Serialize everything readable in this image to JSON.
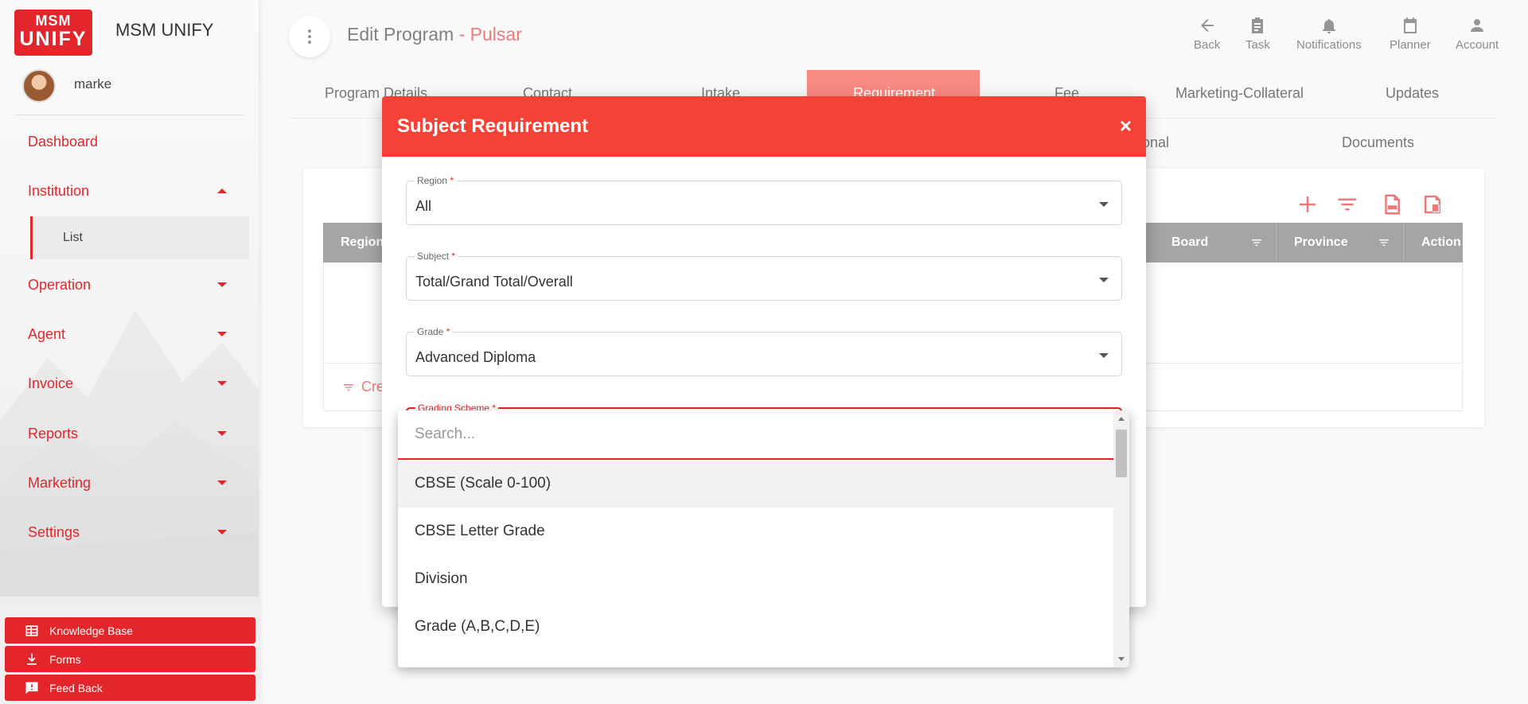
{
  "app": {
    "logo_line1": "MSM",
    "logo_line2": "UNIFY",
    "brand": "MSM UNIFY",
    "user": "marke"
  },
  "sidebar": {
    "items": [
      {
        "label": "Dashboard"
      },
      {
        "label": "Institution"
      },
      {
        "label": "List"
      },
      {
        "label": "Operation"
      },
      {
        "label": "Agent"
      },
      {
        "label": "Invoice"
      },
      {
        "label": "Reports"
      },
      {
        "label": "Marketing"
      },
      {
        "label": "Settings"
      }
    ],
    "bottom": [
      {
        "label": "Knowledge Base",
        "icon": "knowledge-base-icon"
      },
      {
        "label": "Forms",
        "icon": "download-icon"
      },
      {
        "label": "Feed Back",
        "icon": "feedback-icon"
      }
    ]
  },
  "header": {
    "title": "Edit Program",
    "title_accent": "- Pulsar",
    "actions": [
      {
        "label": "Back",
        "icon": "arrow-left-icon"
      },
      {
        "label": "Task",
        "icon": "clipboard-icon"
      },
      {
        "label": "Notifications",
        "icon": "bell-icon"
      },
      {
        "label": "Planner",
        "icon": "calendar-icon"
      },
      {
        "label": "Account",
        "icon": "person-icon"
      }
    ]
  },
  "tabs": {
    "row1": [
      "Program Details",
      "Contact",
      "Intake",
      "Requirement",
      "Fee",
      "Marketing-Collateral",
      "Updates"
    ],
    "row2": [
      "onal",
      "Documents"
    ],
    "active": "Requirement"
  },
  "table": {
    "columns": [
      "Region",
      "Board",
      "Province",
      "Action"
    ],
    "create_label": "Cre"
  },
  "modal": {
    "title": "Subject Requirement",
    "close": "×",
    "fields": {
      "region": {
        "label": "Region",
        "value": "All"
      },
      "subject": {
        "label": "Subject",
        "value": "Total/Grand Total/Overall"
      },
      "grade": {
        "label": "Grade",
        "value": "Advanced Diploma"
      },
      "grading_scheme": {
        "label": "Grading Scheme"
      }
    },
    "required_mark": "*"
  },
  "dropdown": {
    "search_placeholder": "Search...",
    "options": [
      "CBSE (Scale 0-100)",
      "CBSE Letter Grade",
      "Division",
      "Grade (A,B,C,D,E)"
    ]
  },
  "colors": {
    "accent": "#e3262b",
    "modal_header": "#f44336",
    "table_header": "#6f6f6f"
  }
}
